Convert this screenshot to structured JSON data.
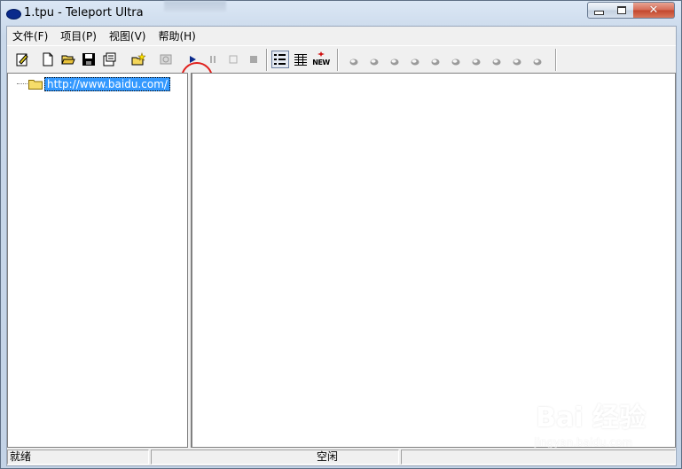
{
  "window": {
    "title": "1.tpu - Teleport Ultra",
    "close_glyph": "✕"
  },
  "menu": [
    {
      "label": "文件(F)"
    },
    {
      "label": "项目(P)"
    },
    {
      "label": "视图(V)"
    },
    {
      "label": "帮助(H)"
    }
  ],
  "toolbar": {
    "new_badge": "NEW",
    "buttons": [
      "project-properties",
      "new",
      "open",
      "save",
      "settings",
      "new-item",
      "disabled-item",
      "start",
      "pause",
      "stop-outline",
      "stop",
      "view-details",
      "view-list",
      "new-items"
    ],
    "indicator_count": 10,
    "highlight_color": "#e0201c"
  },
  "tree": {
    "root_label": "http://www.baidu.com/"
  },
  "status": {
    "left": "就绪",
    "middle": "空闲"
  },
  "watermark": {
    "main": "Bai 经验",
    "sub": "jingyan.baidu.com"
  }
}
